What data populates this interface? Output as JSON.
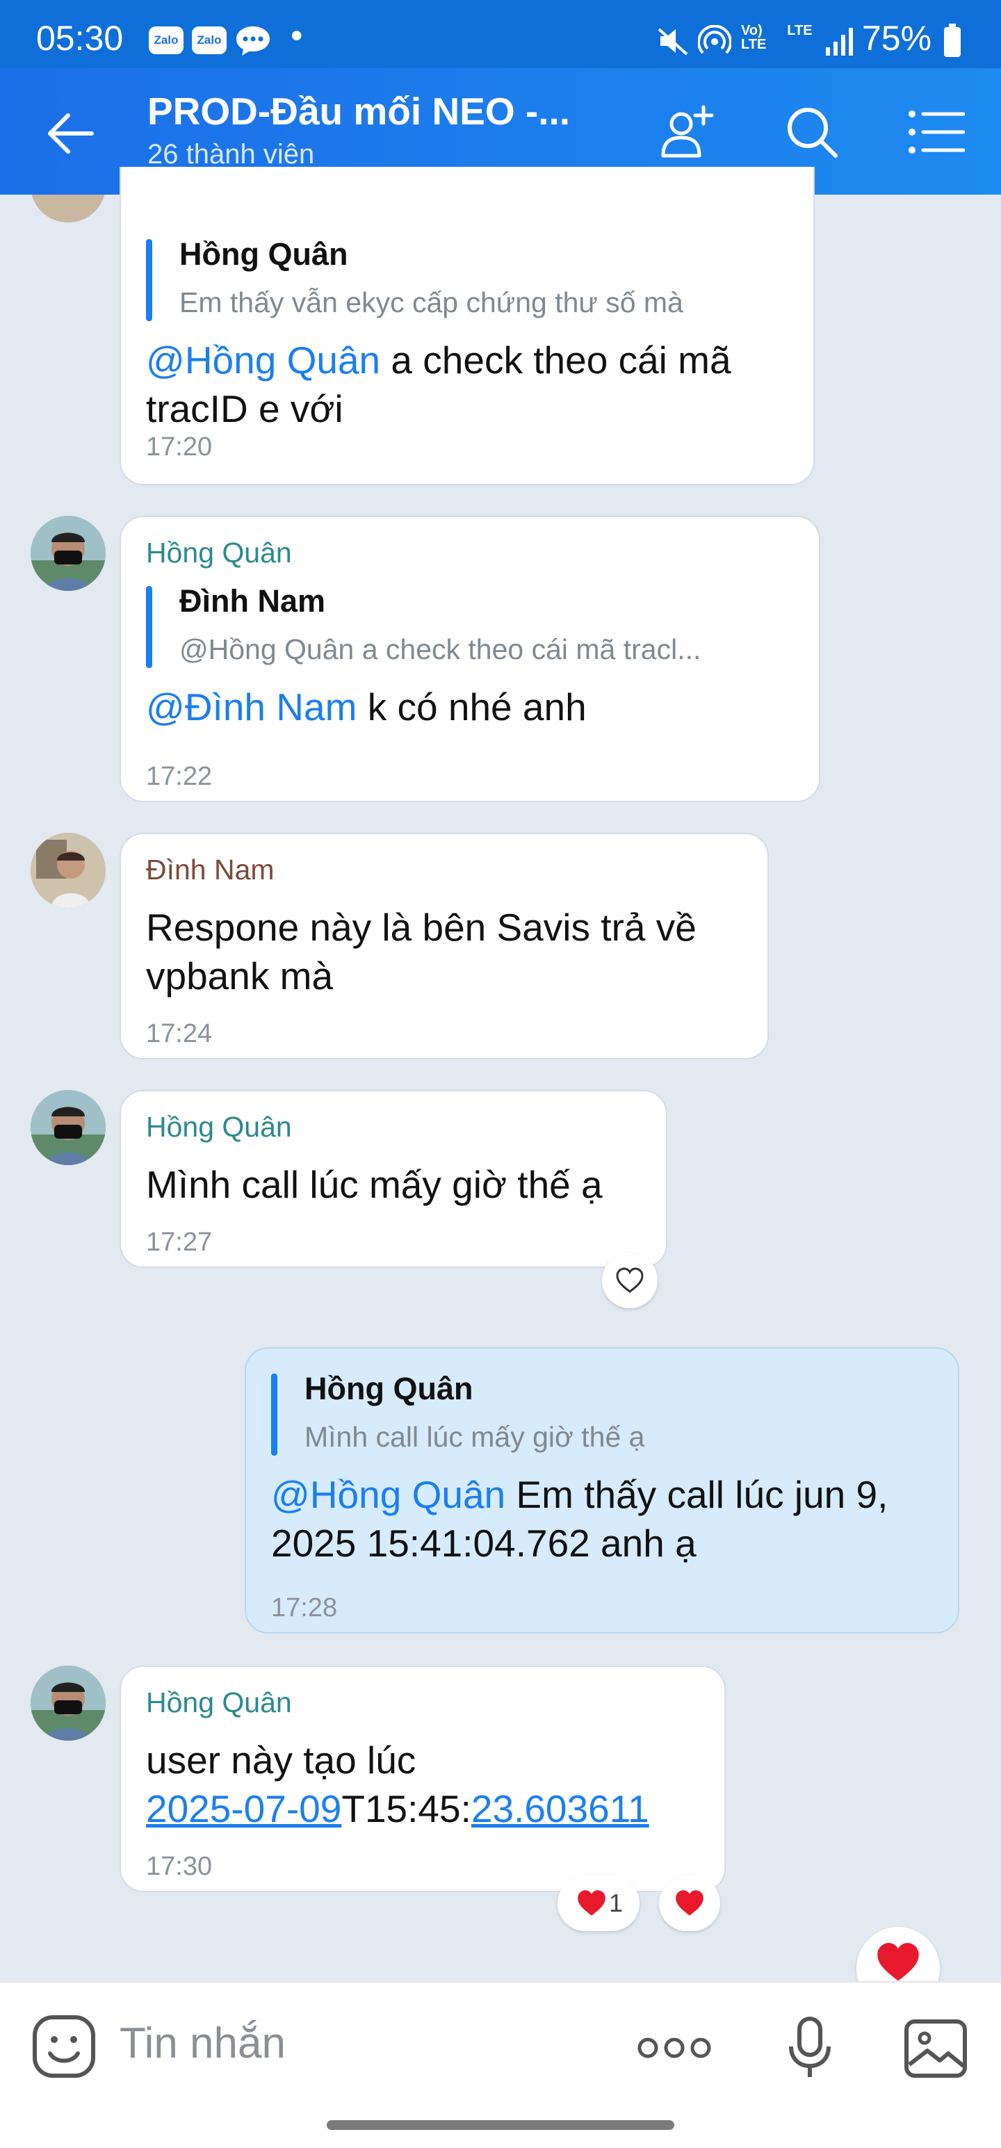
{
  "status_bar": {
    "time": "05:30",
    "app_badge": "Zalo",
    "battery": "75%",
    "network": "Vo) LTE  LTE"
  },
  "header": {
    "title": "PROD-Đầu mối NEO -...",
    "subtitle": "26 thành viên"
  },
  "messages": [
    {
      "id": "m1",
      "quote_name": "Hồng Quân",
      "quote_text": "Em thấy vẫn ekyc cấp chứng thư số mà",
      "mention": "@Hồng Quân",
      "text": " a check theo cái mã tracID e với",
      "time": "17:20"
    },
    {
      "id": "m2",
      "sender": "Hồng Quân",
      "quote_name": "Đình Nam",
      "quote_text": "@Hồng Quân a check theo cái mã tracl...",
      "mention": "@Đình Nam",
      "text": " k có nhé anh",
      "time": "17:22"
    },
    {
      "id": "m3",
      "sender": "Đình Nam",
      "text": "Respone này là bên Savis trả về vpbank mà",
      "time": "17:24"
    },
    {
      "id": "m4",
      "sender": "Hồng Quân",
      "text": "Mình call lúc mấy giờ thế ạ",
      "time": "17:27"
    },
    {
      "id": "m5",
      "quote_name": "Hồng Quân",
      "quote_text": "Mình call lúc mấy giờ thế ạ",
      "mention": "@Hồng Quân",
      "text": " Em thấy call lúc jun 9, 2025 15:41:04.762 anh ạ",
      "time": "17:28"
    },
    {
      "id": "m6",
      "sender": "Hồng Quân",
      "text_prefix": "user này tạo lúc",
      "link1": "2025-07-09",
      "text_mid": "T15:45:",
      "link2": "23.603611",
      "time": "17:30"
    }
  ],
  "reactions": {
    "heart_count": "1"
  },
  "composer": {
    "placeholder": "Tin nhắn"
  },
  "colors": {
    "accent": "#1a7ef0",
    "header": "#1b6fe8",
    "mine_bubble": "#d6ebfc",
    "background": "#e2e9f1",
    "heart": "#e8192c"
  }
}
